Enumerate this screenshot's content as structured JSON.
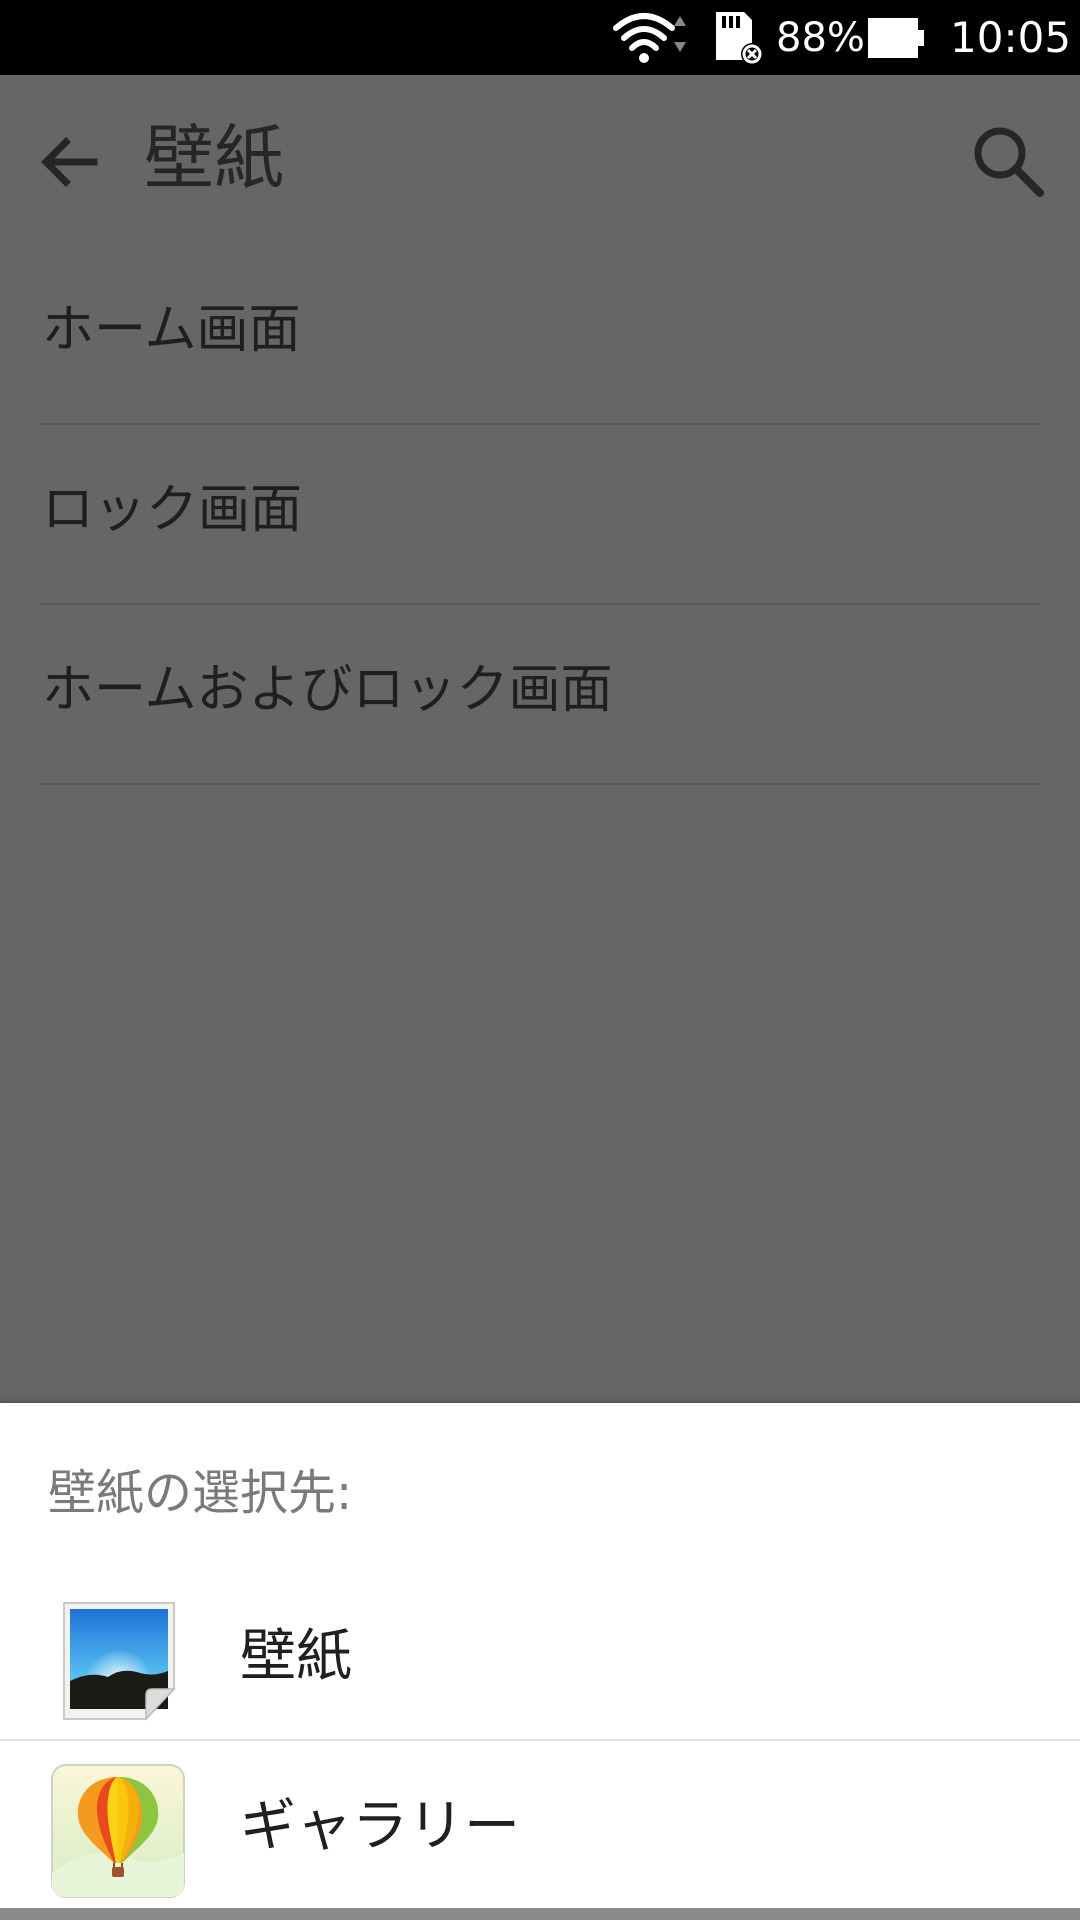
{
  "status_bar": {
    "battery_percent": "88%",
    "time": "10:05",
    "icons": [
      "wifi-icon",
      "data-arrows-icon",
      "sd-card-error-icon",
      "battery-icon"
    ]
  },
  "app_bar": {
    "title": "壁紙",
    "back_icon": "arrow-left-icon",
    "search_icon": "search-icon"
  },
  "settings_list": {
    "items": [
      {
        "label": "ホーム画面"
      },
      {
        "label": "ロック画面"
      },
      {
        "label": "ホームおよびロック画面"
      }
    ]
  },
  "chooser_sheet": {
    "title": "壁紙の選択先:",
    "options": [
      {
        "label": "壁紙",
        "icon": "wallpaper-app-icon"
      },
      {
        "label": "ギャラリー",
        "icon": "gallery-balloon-icon"
      }
    ]
  },
  "colors": {
    "scrim_background": "#666666",
    "status_bar": "#000000",
    "sheet_background": "#ffffff"
  }
}
